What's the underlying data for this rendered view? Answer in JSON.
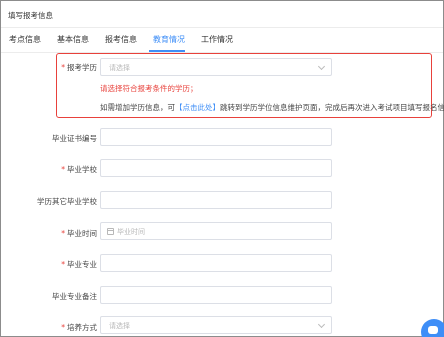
{
  "page": {
    "title": "填写报考信息"
  },
  "tabs": [
    {
      "label": "考点信息"
    },
    {
      "label": "基本信息"
    },
    {
      "label": "报考信息"
    },
    {
      "label": "教育情况"
    },
    {
      "label": "工作情况"
    }
  ],
  "active_tab": "教育情况",
  "form": {
    "required_mark": "*",
    "education_level": {
      "label": "报考学历",
      "placeholder": "请选择",
      "required": true
    },
    "warning": "请选择符合报考条件的学历；",
    "note": {
      "prefix": "如需增加学历信息，可",
      "link": "【点击此处】",
      "suffix": "跳转到学历学位信息维护页面，完成后再次进入考试项目填写报名信息"
    },
    "certificate_no": {
      "label": "毕业证书编号"
    },
    "school": {
      "label": "毕业学校",
      "required": true
    },
    "other_school": {
      "label": "学历其它毕业学校"
    },
    "grad_time": {
      "label": "毕业时间",
      "placeholder": "毕业时间",
      "required": true
    },
    "major": {
      "label": "毕业专业",
      "required": true
    },
    "major_note": {
      "label": "毕业专业备注"
    },
    "training_mode": {
      "label": "培养方式",
      "placeholder": "请选择",
      "required": true
    }
  },
  "colors": {
    "accent": "#3e8ef7",
    "error": "#e8413b"
  }
}
